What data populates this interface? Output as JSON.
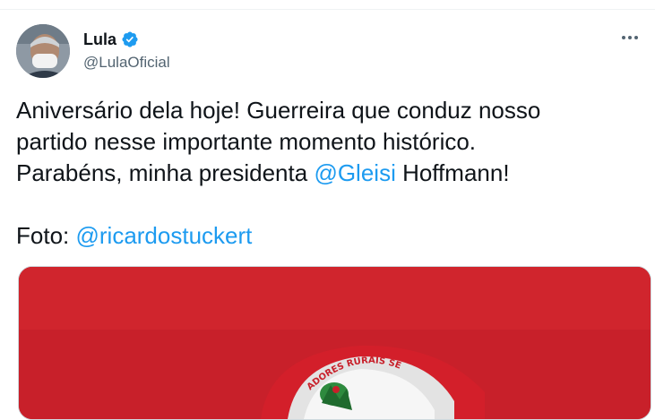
{
  "author": {
    "display_name": "Lula",
    "handle": "@LulaOficial",
    "verified_icon": "verified-badge-icon"
  },
  "tweet": {
    "line1": "Aniversário dela hoje! Guerreira que conduz nosso",
    "line2": "partido nesse importante momento histórico.",
    "line3_pre": "Parabéns, minha presidenta ",
    "line3_mention": "@Gleisi",
    "line3_post": " Hoffmann!",
    "photo_label": "Foto: ",
    "photo_mention": "@ricardostuckert"
  },
  "photo_cap_text": "ADORES RURAIS SEM",
  "colors": {
    "link": "#1d9bf0",
    "verified": "#1d9bf0",
    "text": "#0f1419",
    "secondary": "#536471",
    "photo_background": "#c8202a"
  }
}
